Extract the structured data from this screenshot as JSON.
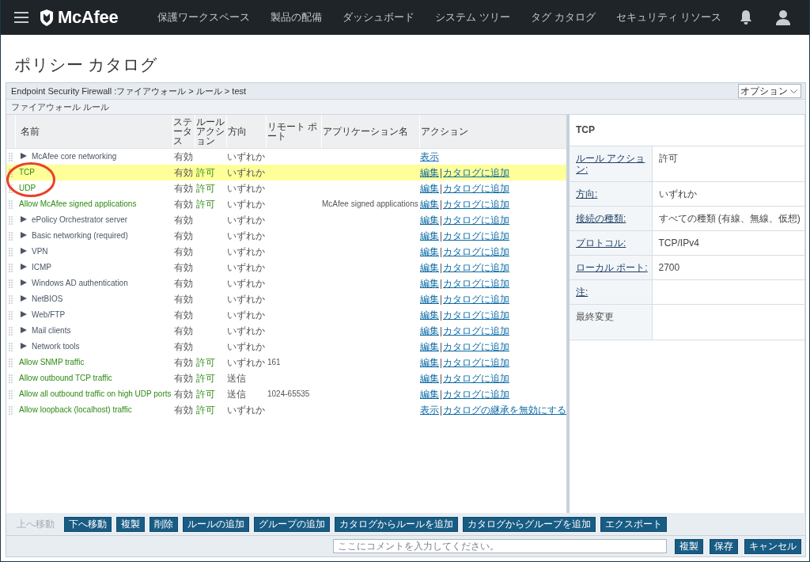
{
  "nav": {
    "brand": "McAfee",
    "items": [
      "保護ワークスペース",
      "製品の配備",
      "ダッシュボード",
      "システム ツリー",
      "タグ カタログ",
      "セキュリティ リソース"
    ]
  },
  "page_title": "ポリシー カタログ",
  "breadcrumb": "Endpoint Security Firewall :ファイアウォール > ルール > test",
  "options_dropdown": "オプション",
  "section_title": "ファイアウォール ルール",
  "table": {
    "columns": [
      "名前",
      "ステータス",
      "ルールアクション",
      "方向",
      "リモート ポート",
      "アプリケーション名",
      "アクション"
    ],
    "rows": [
      {
        "kind": "group",
        "name": "McAfee core networking",
        "expanded": false,
        "selected": false,
        "status": "有効",
        "direction": "いずれか",
        "links": [
          "表示"
        ]
      },
      {
        "kind": "rule",
        "name": "TCP",
        "selected": true,
        "status": "有効",
        "action": "許可",
        "direction": "いずれか",
        "links": [
          "編集",
          "カタログに追加"
        ]
      },
      {
        "kind": "rule",
        "name": "UDP",
        "selected": false,
        "status": "有効",
        "action": "許可",
        "direction": "いずれか",
        "links": [
          "編集",
          "カタログに追加"
        ]
      },
      {
        "kind": "rule",
        "name": "Allow McAfee signed applications",
        "selected": false,
        "status": "有効",
        "action": "許可",
        "direction": "いずれか",
        "application": "McAfee signed applications",
        "links": [
          "編集",
          "カタログに追加"
        ]
      },
      {
        "kind": "group",
        "name": "ePolicy Orchestrator server",
        "expanded": false,
        "selected": false,
        "status": "有効",
        "direction": "いずれか",
        "links": [
          "編集",
          "カタログに追加"
        ]
      },
      {
        "kind": "group",
        "name": "Basic networking (required)",
        "expanded": false,
        "selected": false,
        "status": "有効",
        "direction": "いずれか",
        "links": [
          "編集",
          "カタログに追加"
        ]
      },
      {
        "kind": "group",
        "name": "VPN",
        "expanded": false,
        "selected": false,
        "status": "有効",
        "direction": "いずれか",
        "links": [
          "編集",
          "カタログに追加"
        ]
      },
      {
        "kind": "group",
        "name": "ICMP",
        "expanded": false,
        "selected": false,
        "status": "有効",
        "direction": "いずれか",
        "links": [
          "編集",
          "カタログに追加"
        ]
      },
      {
        "kind": "group",
        "name": "Windows AD authentication",
        "expanded": false,
        "selected": false,
        "status": "有効",
        "direction": "いずれか",
        "links": [
          "編集",
          "カタログに追加"
        ]
      },
      {
        "kind": "group",
        "name": "NetBIOS",
        "expanded": false,
        "selected": false,
        "status": "有効",
        "direction": "いずれか",
        "links": [
          "編集",
          "カタログに追加"
        ]
      },
      {
        "kind": "group",
        "name": "Web/FTP",
        "expanded": false,
        "selected": false,
        "status": "有効",
        "direction": "いずれか",
        "links": [
          "編集",
          "カタログに追加"
        ]
      },
      {
        "kind": "group",
        "name": "Mail clients",
        "expanded": false,
        "selected": false,
        "status": "有効",
        "direction": "いずれか",
        "links": [
          "編集",
          "カタログに追加"
        ]
      },
      {
        "kind": "group",
        "name": "Network tools",
        "expanded": false,
        "selected": false,
        "status": "有効",
        "direction": "いずれか",
        "links": [
          "編集",
          "カタログに追加"
        ]
      },
      {
        "kind": "rule",
        "name": "Allow SNMP traffic",
        "selected": false,
        "status": "有効",
        "action": "許可",
        "direction": "いずれか",
        "remote_port": "161",
        "links": [
          "編集",
          "カタログに追加"
        ]
      },
      {
        "kind": "rule",
        "name": "Allow outbound TCP traffic",
        "selected": false,
        "status": "有効",
        "action": "許可",
        "direction": "送信",
        "links": [
          "編集",
          "カタログに追加"
        ]
      },
      {
        "kind": "rule",
        "name": "Allow all outbound traffic on high UDP ports",
        "selected": false,
        "status": "有効",
        "action": "許可",
        "direction": "送信",
        "remote_port": "1024-65535",
        "links": [
          "編集",
          "カタログに追加"
        ]
      },
      {
        "kind": "rule",
        "name": "Allow loopback (localhost) traffic",
        "selected": false,
        "status": "有効",
        "action": "許可",
        "direction": "いずれか",
        "links": [
          "表示",
          "カタログの継承を無効にする"
        ]
      }
    ]
  },
  "detail": {
    "title": "TCP",
    "properties": [
      {
        "label": "ルール アクション:",
        "value": "許可",
        "link": true
      },
      {
        "label": "方向:",
        "value": "いずれか",
        "link": true
      },
      {
        "label": "接続の種類:",
        "value": "すべての種類 (有線、無線、仮想)",
        "link": true
      },
      {
        "label": "プロトコル:",
        "value": "TCP/IPv4",
        "link": true
      },
      {
        "label": "ローカル ポート:",
        "value": "2700",
        "link": true
      },
      {
        "label": "注:",
        "link": true
      },
      {
        "label": "最終変更",
        "link": false
      }
    ]
  },
  "toolbar": {
    "buttons": [
      {
        "label": "上へ移動",
        "disabled": true
      },
      {
        "label": "下へ移動",
        "disabled": false
      },
      {
        "label": "複製",
        "disabled": false
      },
      {
        "label": "削除",
        "disabled": false
      },
      {
        "label": "ルールの追加",
        "disabled": false
      },
      {
        "label": "グループの追加",
        "disabled": false
      },
      {
        "label": "カタログからルールを追加",
        "disabled": false
      },
      {
        "label": "カタログからグループを追加",
        "disabled": false
      },
      {
        "label": "エクスポート",
        "disabled": false
      }
    ]
  },
  "comment": {
    "placeholder": "ここにコメントを入力してください。"
  },
  "footer_buttons": [
    "複製",
    "保存",
    "キャンセル"
  ]
}
